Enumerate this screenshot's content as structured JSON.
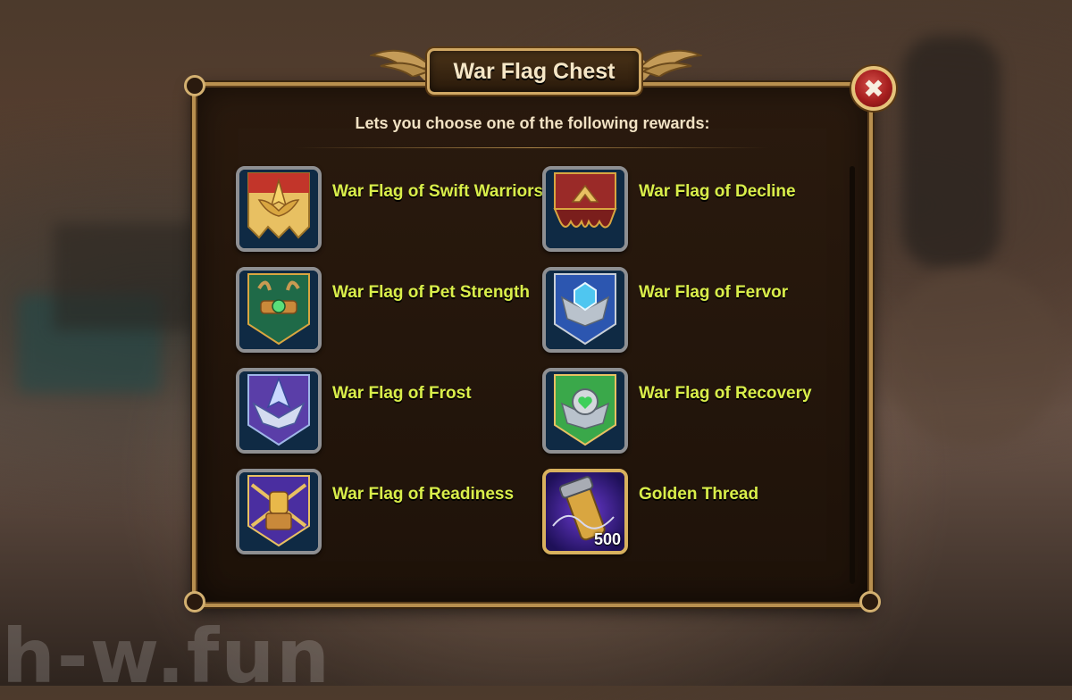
{
  "window": {
    "title": "War Flag Chest",
    "close_icon": "close-x-icon"
  },
  "subtitle": "Lets you choose one of the following rewards:",
  "rewards": [
    {
      "label": "War Flag of Swift Warriors",
      "icon": "swift-warriors-flag-icon"
    },
    {
      "label": "War Flag of Decline",
      "icon": "decline-flag-icon"
    },
    {
      "label": "War Flag of Pet Strength",
      "icon": "pet-strength-flag-icon"
    },
    {
      "label": "War Flag of Fervor",
      "icon": "fervor-flag-icon"
    },
    {
      "label": "War Flag of Frost",
      "icon": "frost-flag-icon"
    },
    {
      "label": "War Flag of Recovery",
      "icon": "recovery-flag-icon"
    },
    {
      "label": "War Flag of Readiness",
      "icon": "readiness-flag-icon"
    },
    {
      "label": "Golden Thread",
      "icon": "golden-thread-icon",
      "quantity": "500"
    }
  ],
  "watermark": "h-w.fun",
  "colors": {
    "label": "#d9ee4a",
    "frame_gold": "#d8b15e",
    "close_button": "#a51e1e"
  }
}
